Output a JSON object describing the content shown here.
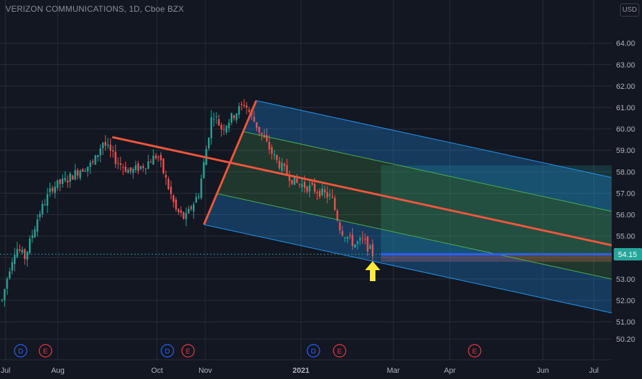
{
  "title": "VERIZON COMMUNICATIONS, 1D, Cboe BZX",
  "currency": "USD",
  "colors": {
    "background": "#131722",
    "grid": "#2a2e39",
    "axis_text": "#b2b5be",
    "candle_up": "#26a69a",
    "candle_down": "#ef5350",
    "pitchfork_median": "#f0563d",
    "channel_outer": "#2196f3",
    "channel_inner": "#4caf50",
    "price_label": "#26a69a",
    "event_dividend": "#2962ff",
    "event_earnings": "#f23645",
    "arrow": "#ffeb3b"
  },
  "chart_data": {
    "type": "candlestick",
    "y_ticks": [
      "64.00",
      "63.00",
      "62.00",
      "61.00",
      "60.00",
      "59.00",
      "58.00",
      "57.00",
      "56.00",
      "55.00",
      "54.00",
      "53.00",
      "52.00",
      "51.00",
      "50.20"
    ],
    "x_ticks": [
      "Jul",
      "Aug",
      "Oct",
      "Nov",
      "2021",
      "Mar",
      "Apr",
      "Jun",
      "Jul"
    ],
    "last_price": "54.15",
    "events": [
      "D",
      "E",
      "D",
      "E",
      "D",
      "E",
      "E"
    ],
    "pitchfork_anchors": [
      [
        "Aug",
        59.55
      ],
      [
        "Nov",
        61.35
      ],
      [
        "Nov",
        55.5
      ]
    ],
    "position_box": {
      "entry": 54.15,
      "target": 58.3,
      "stop": 53.8
    },
    "price_series_approx": [
      [
        0,
        52.0
      ],
      [
        8,
        53.5
      ],
      [
        15,
        54.5
      ],
      [
        25,
        54.0
      ],
      [
        40,
        56.0
      ],
      [
        55,
        57.3
      ],
      [
        70,
        57.6
      ],
      [
        85,
        58.1
      ],
      [
        100,
        58.4
      ],
      [
        110,
        59.4
      ],
      [
        125,
        58.5
      ],
      [
        140,
        58.0
      ],
      [
        155,
        58.3
      ],
      [
        170,
        58.8
      ],
      [
        180,
        57.5
      ],
      [
        190,
        56.2
      ],
      [
        200,
        55.8
      ],
      [
        215,
        57.0
      ],
      [
        230,
        60.8
      ],
      [
        240,
        60.0
      ],
      [
        250,
        60.5
      ],
      [
        265,
        61.2
      ],
      [
        280,
        60.0
      ],
      [
        300,
        58.5
      ],
      [
        320,
        57.5
      ],
      [
        340,
        57.2
      ],
      [
        350,
        57.0
      ],
      [
        360,
        56.8
      ],
      [
        370,
        55.3
      ],
      [
        385,
        54.6
      ],
      [
        395,
        54.8
      ],
      [
        405,
        54.15
      ]
    ]
  }
}
